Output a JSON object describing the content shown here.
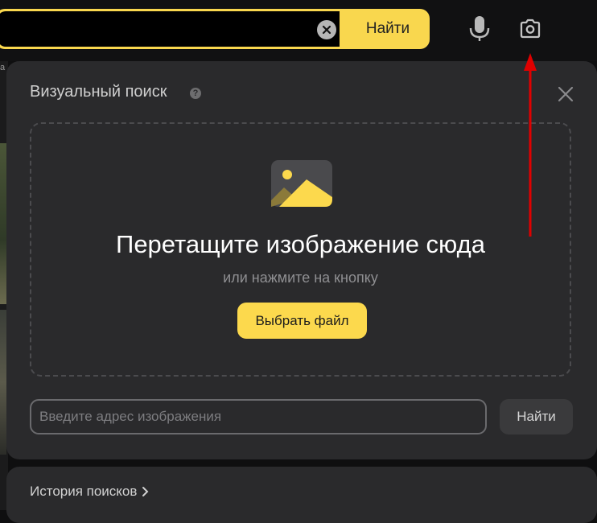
{
  "search": {
    "query": "",
    "find_label": "Найти"
  },
  "icons": {
    "clear": "close-icon",
    "mic": "microphone-icon",
    "camera": "camera-icon",
    "help": "question-icon",
    "close": "close-icon",
    "image": "image-icon",
    "chevron": "chevron-right-icon"
  },
  "left_strip": {
    "text": "a"
  },
  "visual_search": {
    "title": "Визуальный поиск",
    "help_glyph": "?",
    "drop_title": "Перетащите изображение сюда",
    "drop_subtitle": "или нажмите на кнопку",
    "choose_file_label": "Выбрать файл",
    "url_placeholder": "Введите адрес изображения",
    "url_find_label": "Найти"
  },
  "history": {
    "label": "История поисков"
  },
  "colors": {
    "accent": "#fcd94d",
    "panel_bg": "#2a2a2c",
    "annotation_arrow": "#e00000"
  }
}
